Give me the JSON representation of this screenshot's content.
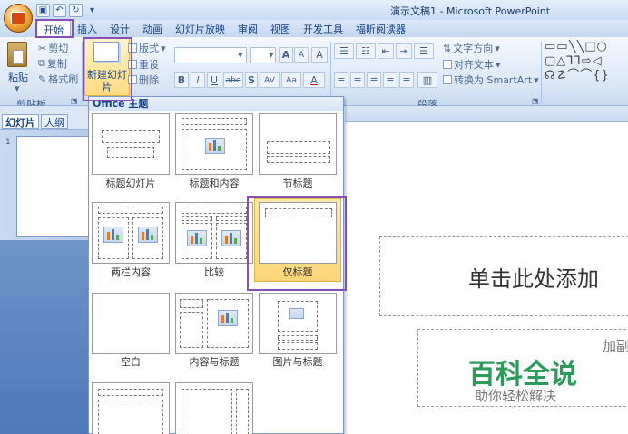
{
  "app": {
    "title": "演示文稿1 - Microsoft PowerPoint"
  },
  "tabs": [
    "开始",
    "插入",
    "设计",
    "动画",
    "幻灯片放映",
    "审阅",
    "视图",
    "开发工具",
    "福昕阅读器"
  ],
  "clipboard": {
    "paste": "粘贴",
    "cut": "剪切",
    "copy": "复制",
    "format_painter": "格式刷",
    "label": "剪贴板"
  },
  "slides_group": {
    "new_slide": "新建幻灯片",
    "layout": "版式",
    "reset": "重设",
    "delete": "删除"
  },
  "font_group": {
    "grow": "A",
    "shrink": "A",
    "clear": "A",
    "bold": "B",
    "italic": "I",
    "underline": "U",
    "strike": "abe",
    "shadow": "S",
    "spacing": "AV",
    "case": "Aa",
    "color": "A"
  },
  "paragraph_group": {
    "text_direction": "文字方向",
    "align_text": "对齐文本",
    "smartart": "转换为 SmartArt",
    "label": "段落"
  },
  "left_pane": {
    "tabs": [
      "幻灯片",
      "大纲"
    ],
    "slide_number": "1"
  },
  "dropdown": {
    "header": "Office 主题",
    "layouts": [
      {
        "label": "标题幻灯片"
      },
      {
        "label": "标题和内容"
      },
      {
        "label": "节标题"
      },
      {
        "label": "两栏内容"
      },
      {
        "label": "比较"
      },
      {
        "label": "仅标题",
        "selected": true
      },
      {
        "label": "空白"
      },
      {
        "label": "内容与标题"
      },
      {
        "label": "图片与标题"
      },
      {
        "label": ""
      },
      {
        "label": ""
      }
    ]
  },
  "slide": {
    "title_placeholder": "单击此处添加",
    "subtitle_placeholder": "加副"
  },
  "watermark": {
    "main": "百科全说",
    "sub": "助你轻松解决"
  },
  "colors": {
    "accent": "#8a4fb4",
    "ribbon": "#dbe7f6",
    "selected": "#fbd67a",
    "watermark": "#2b9b5a"
  }
}
